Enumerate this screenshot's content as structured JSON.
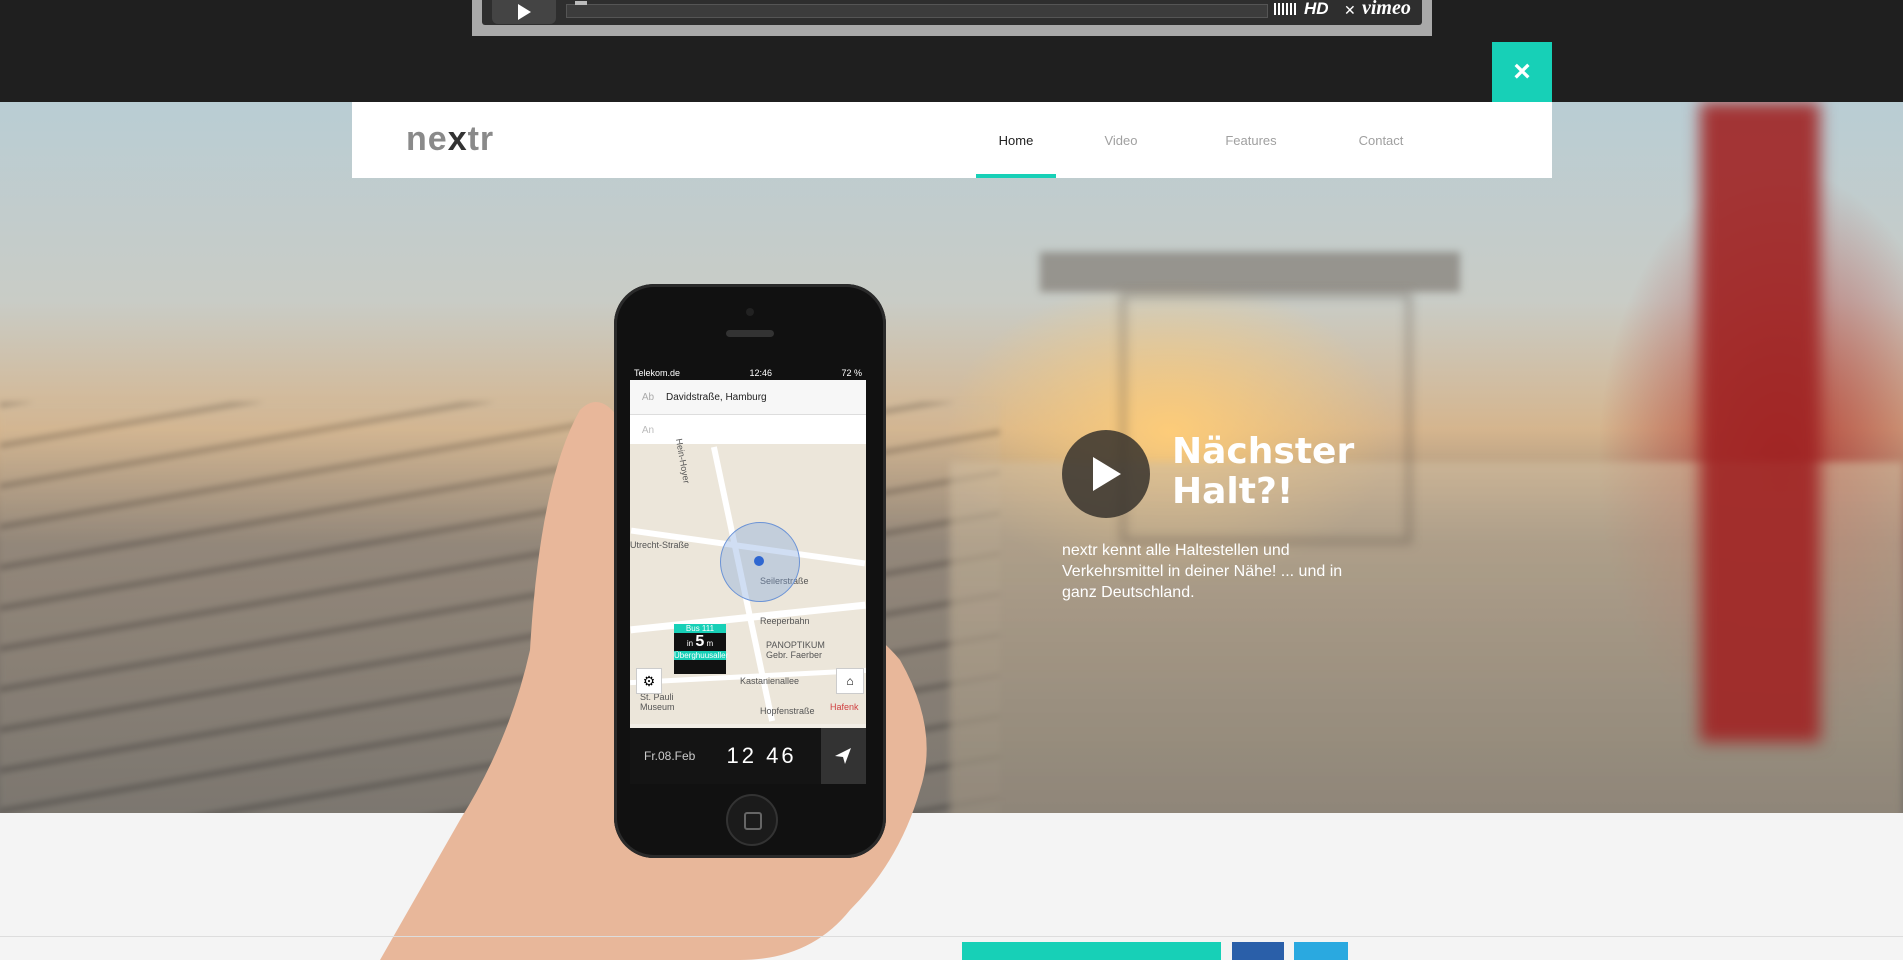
{
  "video": {
    "hd_label": "HD",
    "brand": "vimeo"
  },
  "close_label": "×",
  "nav": {
    "logo": "nextr",
    "items": [
      {
        "label": "Home",
        "active": true
      },
      {
        "label": "Video",
        "active": false
      },
      {
        "label": "Features",
        "active": false
      },
      {
        "label": "Contact",
        "active": false
      }
    ]
  },
  "hero": {
    "title_line1": "Nächster",
    "title_line2": "Halt?!",
    "text": "nextr kennt alle Haltestellen und Verkehrsmittel in deiner Nähe! ... und in ganz Deutschland."
  },
  "phone_screen": {
    "carrier": "Telekom.de",
    "time": "12:46",
    "battery": "72 %",
    "from_label": "Ab",
    "from_value": "Davidstraße, Hamburg",
    "to_label": "An",
    "streets": [
      "Hein-Hoyer",
      "Seilerstraße",
      "Reeperbahn",
      "Kastanienallee",
      "Hopfenstraße",
      "Utrecht-Straße",
      "St. Pauli Museum",
      "PANOPTIKUM Gebr. Faerber",
      "Hafenk"
    ],
    "bus_label": "Bus 111",
    "bus_in": "in",
    "bus_minutes": "5",
    "bus_unit": "m",
    "bus_stop": "Überghuusaller",
    "date": "Fr.08.Feb",
    "clock": "12 46"
  },
  "colors": {
    "accent": "#17d0b7",
    "dark": "#1f1f1f"
  }
}
